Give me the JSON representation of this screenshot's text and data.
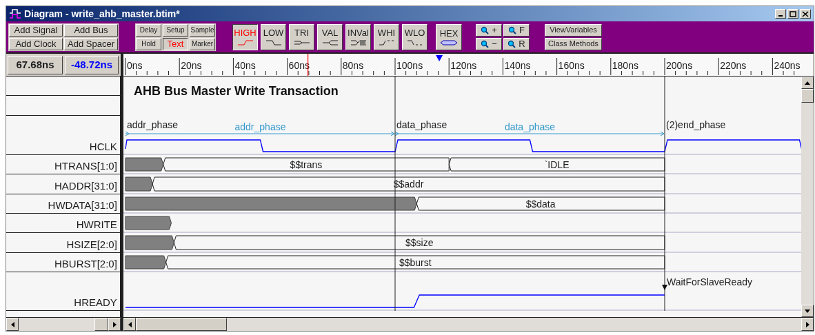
{
  "window": {
    "title": "Diagram - write_ahb_master.btim*"
  },
  "toolbar": {
    "add_buttons": [
      "Add Signal",
      "Add Bus",
      "Add Clock",
      "Add Spacer"
    ],
    "timing_buttons": [
      {
        "label": "Delay",
        "selected": false
      },
      {
        "label": "Setup",
        "selected": false
      },
      {
        "label": "Sample",
        "selected": false
      },
      {
        "label": "Hold",
        "selected": false
      },
      {
        "label": "Text",
        "selected": true
      },
      {
        "label": "Marker",
        "selected": false
      }
    ],
    "wave_buttons": [
      {
        "label": "HIGH",
        "selected": true
      },
      {
        "label": "LOW",
        "selected": false
      },
      {
        "label": "TRI",
        "selected": false
      },
      {
        "label": "VAL",
        "selected": false
      },
      {
        "label": "INVal",
        "selected": false
      },
      {
        "label": "WHI",
        "selected": false
      },
      {
        "label": "WLO",
        "selected": false
      }
    ],
    "hex_button": {
      "label": "HEX"
    },
    "zoom_buttons": [
      "+",
      "F",
      "−",
      "R"
    ],
    "class_buttons": [
      "ViewVariables",
      "Class Methods"
    ]
  },
  "cursor_readouts": {
    "cursor": "67.68ns",
    "delta": "-48.72ns"
  },
  "ruler_ticks": [
    "0ns",
    "20ns",
    "40ns",
    "60ns",
    "80ns",
    "100ns",
    "120ns",
    "140ns",
    "160ns",
    "180ns",
    "200ns",
    "220ns",
    "240ns"
  ],
  "diagram": {
    "title": "AHB Bus Master Write Transaction",
    "phases": [
      {
        "label": "addr_phase",
        "span_label": "addr_phase"
      },
      {
        "label": "data_phase",
        "span_label": "data_phase"
      },
      {
        "label": "(2)end_phase"
      }
    ],
    "wait_marker": {
      "label": "WaitForSlaveReady"
    },
    "signals": [
      {
        "name": "HCLK",
        "kind": "clock"
      },
      {
        "name": "HTRANS[1:0]",
        "kind": "bus",
        "values": [
          "$$trans",
          "`IDLE"
        ]
      },
      {
        "name": "HADDR[31:0]",
        "kind": "bus",
        "values": [
          "$$addr"
        ]
      },
      {
        "name": "HWDATA[31:0]",
        "kind": "bus",
        "values": [
          "$$data"
        ]
      },
      {
        "name": "HWRITE",
        "kind": "bus"
      },
      {
        "name": "HSIZE[2:0]",
        "kind": "bus",
        "values": [
          "$$size"
        ]
      },
      {
        "name": "HBURST[2:0]",
        "kind": "bus",
        "values": [
          "$$burst"
        ]
      },
      {
        "name": "HREADY",
        "kind": "bit"
      }
    ]
  }
}
